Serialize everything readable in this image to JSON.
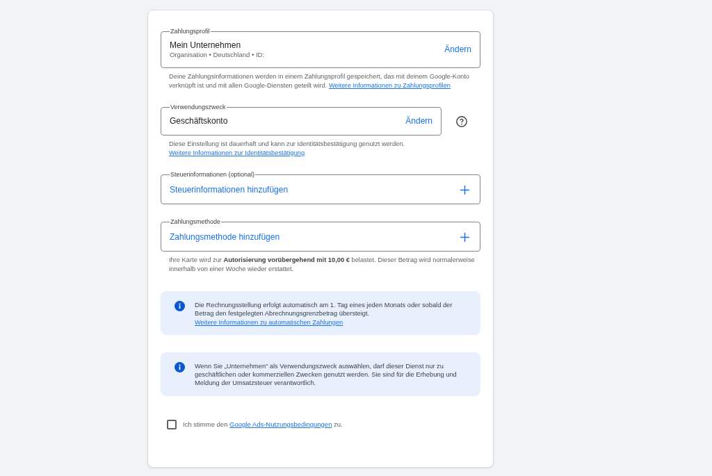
{
  "sections": [
    {
      "kind": "value",
      "legend": "Zahlungsprofil",
      "value": "Mein Unternehmen",
      "subtitle": "Organisation • Deutschland • ID:",
      "action": "Ändern",
      "note": {
        "text": "Deine Zahlungsinformationen werden in einem Zahlungsprofil gespeichert, das mit deinem Google-Konto verknüpft ist und mit allen Google-Diensten geteilt wird.",
        "link": "Weitere Informationen zu Zahlungsprofilen"
      }
    },
    {
      "kind": "value",
      "legend": "Verwendungszweck",
      "value": "Geschäftskonto",
      "action": "Ändern",
      "help_icon": true,
      "note": {
        "text": "Diese Einstellung ist dauerhaft und kann zur Identitätsbestätigung genutzt werden.",
        "link": "Weitere Informationen zur Identitätsbestätigung"
      }
    },
    {
      "kind": "add",
      "legend": "Steuerinformationen (optional)",
      "action": "Steuerinformationen hinzufügen"
    },
    {
      "kind": "add",
      "legend": "Zahlungsmethode",
      "action": "Zahlungsmethode hinzufügen",
      "note": {
        "text": "Ihre Karte wird zur **Autorisierung vorübergehend mit 10,00 €** belastet. Dieser Betrag wird normalerweise innerhalb von einer Woche wieder erstattet."
      }
    }
  ],
  "notices": [
    {
      "text": "Die Rechnungsstellung erfolgt automatisch am 1. Tag eines jeden Monats oder sobald der Betrag den festgelegten Abrechnungsgrenzbetrag übersteigt.",
      "link": "Weitere Informationen zu automatischen Zahlungen"
    },
    {
      "text": "Wenn Sie „Unternehmen“ als Verwendungszweck auswählen, darf dieser Dienst nur zu geschäftlichen oder kommerziellen Zwecken genutzt werden. Sie sind für die Erhebung und Meldung der Umsatzsteuer verantwortlich."
    }
  ],
  "terms": {
    "checked": false,
    "text_before": "Ich stimme den",
    "link": "Google Ads-Nutzungsbedingungen",
    "text_after": "zu."
  }
}
